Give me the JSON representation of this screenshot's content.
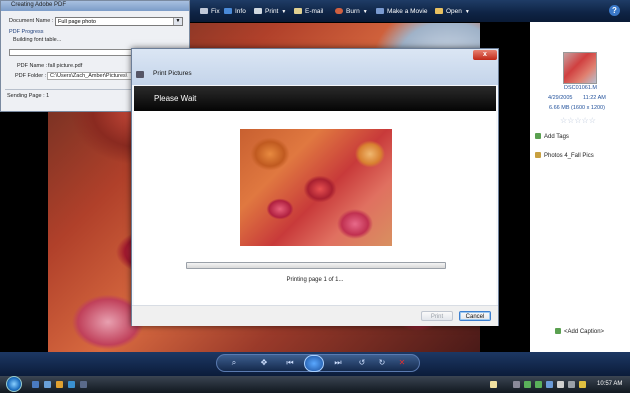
{
  "toolbar": {
    "items": [
      {
        "label": "Fix",
        "has_menu": false
      },
      {
        "label": "Info",
        "has_menu": false
      },
      {
        "label": "Print",
        "has_menu": true
      },
      {
        "label": "E-mail",
        "has_menu": false
      },
      {
        "label": "Burn",
        "has_menu": true
      },
      {
        "label": "Make a Movie",
        "has_menu": false
      },
      {
        "label": "Open",
        "has_menu": true
      }
    ],
    "help_glyph": "?"
  },
  "pdf_window": {
    "title": "Creating Adobe PDF",
    "document_name_label": "Document Name :",
    "document_name_value": "Full page photo",
    "progress_group_label": "PDF Progress",
    "status": "Building font table...",
    "pdf_name_label": "PDF Name :",
    "pdf_name_value": "fall picture.pdf",
    "pdf_folder_label": "PDF Folder :",
    "pdf_folder_value": "C:\\Users\\Zach_Amber\\Pictures\\",
    "sending_page": "Sending Page : 1"
  },
  "print_dialog": {
    "title": "Print Pictures",
    "close_glyph": "x",
    "banner": "Please Wait",
    "status": "Printing page 1 of 1...",
    "print_button": "Print",
    "cancel_button": "Cancel"
  },
  "info_panel": {
    "filename": "DSC01061.M",
    "date": "4/29/2005",
    "time": "11:22 AM",
    "details": "6.66 MB (1600 x 1200)",
    "rating_stars": "☆☆☆☆☆",
    "add_tags": "Add Tags",
    "tag": "Photos 4_Fall Pics",
    "add_caption": "<Add Caption>"
  },
  "controls": {
    "zoom": "⌕",
    "fit": "✥",
    "prev": "⏮",
    "next": "⏭",
    "rotate_ccw": "↺",
    "rotate_cw": "↻",
    "delete": "✕"
  },
  "taskbar": {
    "clock": "10:57 AM"
  },
  "colors": {
    "gallery_toolbar": "#0e2344",
    "dialog_banner": "#050505",
    "info_text": "#1f4f9a",
    "cancel_focus": "#3c7fd0"
  }
}
